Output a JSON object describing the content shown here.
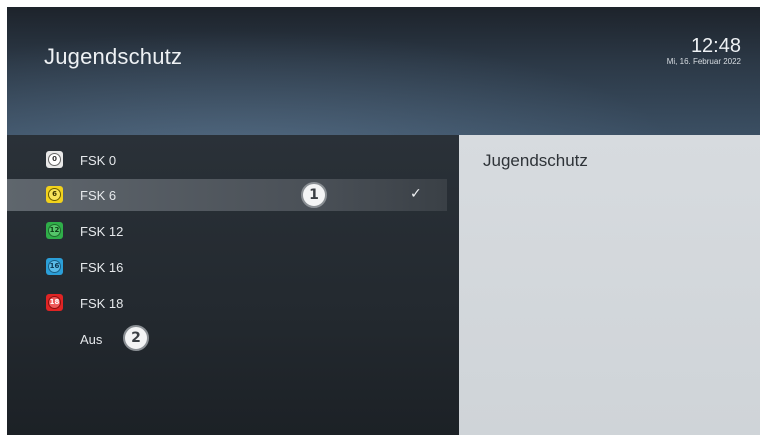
{
  "header": {
    "title": "Jugendschutz",
    "time": "12:48",
    "date": "Mi, 16. Februar 2022"
  },
  "menu": {
    "items": [
      {
        "label": "FSK 0",
        "icon": "fsk-0-icon",
        "badge": "0",
        "color": "#e8e8e8",
        "selected": false
      },
      {
        "label": "FSK 6",
        "icon": "fsk-6-icon",
        "badge": "6",
        "color": "#f2d21b",
        "selected": true
      },
      {
        "label": "FSK 12",
        "icon": "fsk-12-icon",
        "badge": "12",
        "color": "#2fae49",
        "selected": false
      },
      {
        "label": "FSK 16",
        "icon": "fsk-16-icon",
        "badge": "16",
        "color": "#2b9fd8",
        "selected": false
      },
      {
        "label": "FSK 18",
        "icon": "fsk-18-icon",
        "badge": "18",
        "color": "#e02424",
        "selected": false
      },
      {
        "label": "Aus",
        "icon": "",
        "badge": "",
        "color": "",
        "selected": false
      }
    ],
    "checkmark": "✓"
  },
  "info_panel": {
    "title": "Jugendschutz"
  },
  "callouts": [
    "1",
    "2"
  ]
}
